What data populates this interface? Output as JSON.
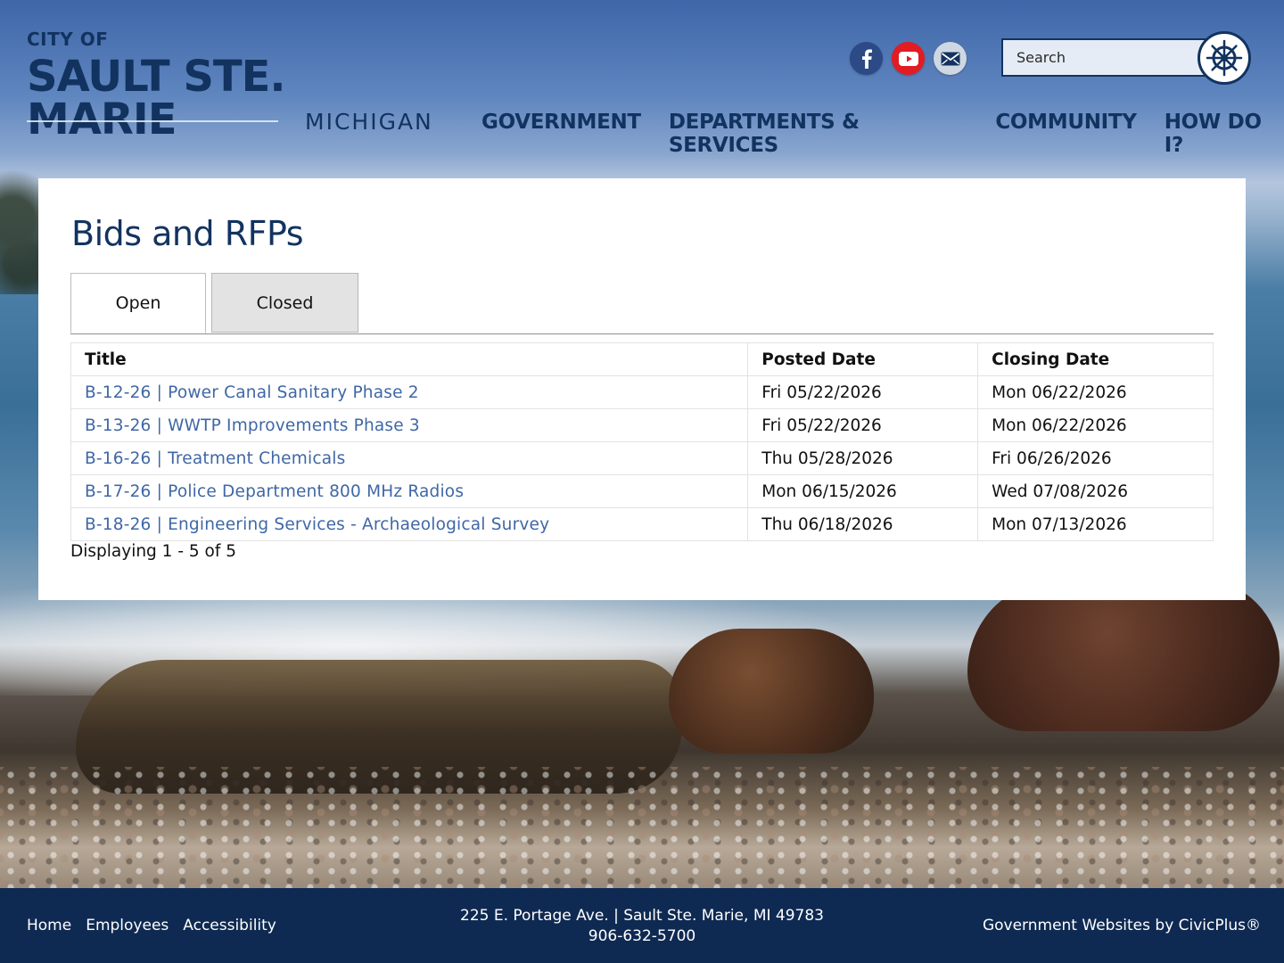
{
  "header": {
    "logo": {
      "city_of": "CITY OF",
      "city_name": "SAULT STE. MARIE",
      "state": "MICHIGAN"
    },
    "social": [
      {
        "name": "facebook",
        "icon": "facebook-icon"
      },
      {
        "name": "youtube",
        "icon": "youtube-icon"
      },
      {
        "name": "email",
        "icon": "mail-icon"
      }
    ],
    "search": {
      "placeholder": "Search",
      "value": "",
      "icon": "ship-wheel-icon"
    },
    "nav": [
      {
        "label": "GOVERNMENT"
      },
      {
        "label": "DEPARTMENTS & SERVICES"
      },
      {
        "label": "COMMUNITY"
      },
      {
        "label": "HOW DO I?"
      }
    ]
  },
  "main": {
    "title": "Bids and RFPs",
    "tabs": [
      {
        "label": "Open",
        "active": true
      },
      {
        "label": "Closed",
        "active": false
      }
    ],
    "table": {
      "headers": [
        "Title",
        "Posted Date",
        "Closing Date"
      ],
      "rows": [
        [
          "B-12-26 | Power Canal Sanitary Phase 2",
          "Fri 05/22/2026",
          "Mon 06/22/2026"
        ],
        [
          "B-13-26 | WWTP Improvements Phase 3",
          "Fri 05/22/2026",
          "Mon 06/22/2026"
        ],
        [
          "B-16-26 | Treatment Chemicals",
          "Thu 05/28/2026",
          "Fri 06/26/2026"
        ],
        [
          "B-17-26 | Police Department 800 MHz Radios",
          "Mon 06/15/2026",
          "Wed 07/08/2026"
        ],
        [
          "B-18-26 | Engineering Services - Archaeological Survey",
          "Thu 06/18/2026",
          "Mon 07/13/2026"
        ]
      ]
    },
    "count_text": "Displaying 1 - 5 of 5"
  },
  "footer": {
    "links": [
      {
        "label": "Home"
      },
      {
        "label": "Employees"
      },
      {
        "label": "Accessibility"
      }
    ],
    "address": "225 E. Portage Ave. | Sault Ste. Marie, MI 49783",
    "phone": "906-632-5700",
    "credit": "Government Websites by CivicPlus®"
  },
  "colors": {
    "brand_navy": "#12335f",
    "link_blue": "#3f67a6",
    "footer_bg": "#0f2a52",
    "facebook": "#2b4a86",
    "youtube": "#e11d23"
  }
}
